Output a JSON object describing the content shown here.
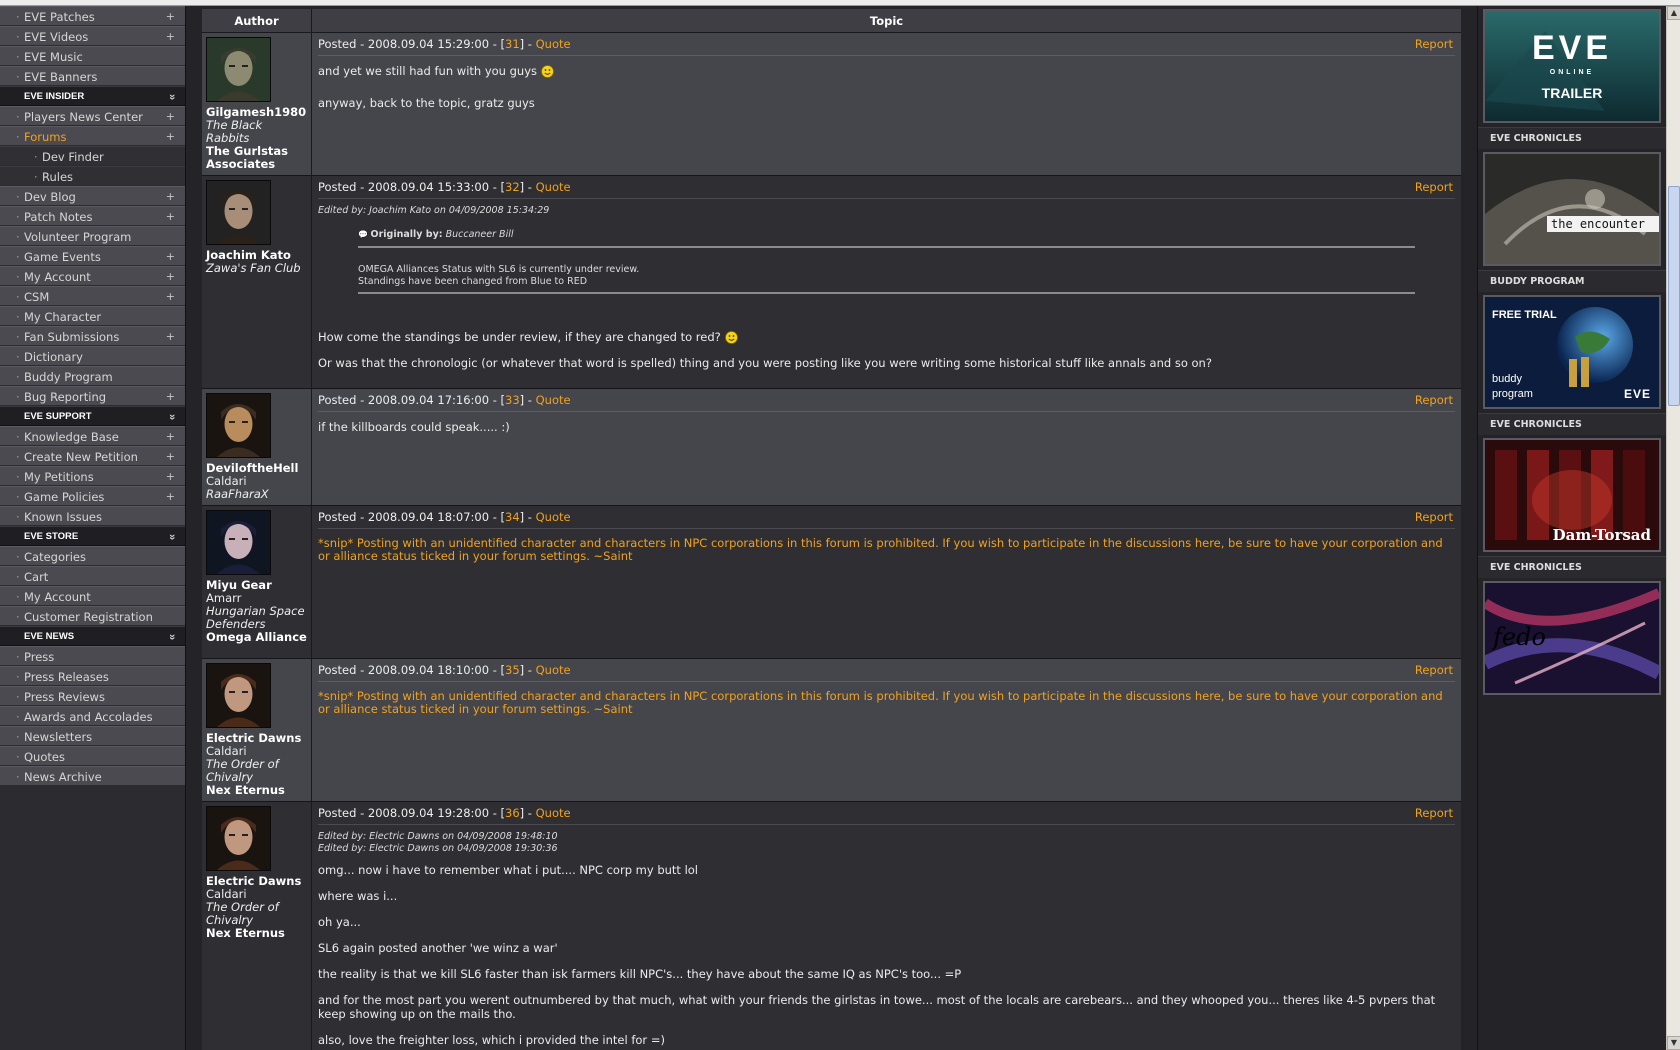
{
  "nav": {
    "groups": [
      {
        "heading": null,
        "items": [
          {
            "label": "EVE Patches",
            "plus": true
          },
          {
            "label": "EVE Videos",
            "plus": true
          },
          {
            "label": "EVE Music",
            "plus": false
          },
          {
            "label": "EVE Banners",
            "plus": false
          }
        ]
      },
      {
        "heading": "EVE INSIDER",
        "items": [
          {
            "label": "Players News Center",
            "plus": true
          },
          {
            "label": "Forums",
            "plus": true,
            "active": true
          },
          {
            "label": "Dev Finder",
            "plus": false,
            "sub": true
          },
          {
            "label": "Rules",
            "plus": false,
            "sub": true
          },
          {
            "label": "Dev Blog",
            "plus": true
          },
          {
            "label": "Patch Notes",
            "plus": true
          },
          {
            "label": "Volunteer Program",
            "plus": false
          },
          {
            "label": "Game Events",
            "plus": true
          },
          {
            "label": "My Account",
            "plus": true
          },
          {
            "label": "CSM",
            "plus": true
          },
          {
            "label": "My Character",
            "plus": false
          },
          {
            "label": "Fan Submissions",
            "plus": true
          },
          {
            "label": "Dictionary",
            "plus": false
          },
          {
            "label": "Buddy Program",
            "plus": false
          },
          {
            "label": "Bug Reporting",
            "plus": true
          }
        ]
      },
      {
        "heading": "EVE SUPPORT",
        "items": [
          {
            "label": "Knowledge Base",
            "plus": true
          },
          {
            "label": "Create New Petition",
            "plus": true
          },
          {
            "label": "My Petitions",
            "plus": true
          },
          {
            "label": "Game Policies",
            "plus": true
          },
          {
            "label": "Known Issues",
            "plus": false
          }
        ]
      },
      {
        "heading": "EVE STORE",
        "items": [
          {
            "label": "Categories",
            "plus": false
          },
          {
            "label": "Cart",
            "plus": false
          },
          {
            "label": "My Account",
            "plus": false
          },
          {
            "label": "Customer Registration",
            "plus": false
          }
        ]
      },
      {
        "heading": "EVE NEWS",
        "items": [
          {
            "label": "Press",
            "plus": false
          },
          {
            "label": "Press Releases",
            "plus": false
          },
          {
            "label": "Press Reviews",
            "plus": false
          },
          {
            "label": "Awards and Accolades",
            "plus": false
          },
          {
            "label": "Newsletters",
            "plus": false
          },
          {
            "label": "Quotes",
            "plus": false
          },
          {
            "label": "News Archive",
            "plus": false
          }
        ]
      }
    ]
  },
  "forum": {
    "headers": {
      "author": "Author",
      "topic": "Topic"
    },
    "quote_label": "Quote",
    "report_label": "Report",
    "posted_prefix": "Posted - ",
    "posts": [
      {
        "author": "Gilgamesh1980",
        "race": "",
        "corp": "The Black Rabbits",
        "alliance": "The Gurlstas Associates",
        "date": "2008.09.04 15:29:00",
        "num": "31",
        "avatar": "male1",
        "paragraphs": [
          "and yet we still had fun with you guys",
          "anyway, back to the topic, gratz guys"
        ],
        "smile_after": [
          0
        ]
      },
      {
        "author": "Joachim Kato",
        "race": "",
        "corp": "Zawa's Fan Club",
        "alliance": "",
        "date": "2008.09.04 15:33:00",
        "num": "32",
        "avatar": "male2",
        "edited": [
          "Edited by: Joachim Kato on 04/09/2008 15:34:29"
        ],
        "quote": {
          "label": "Originally by:",
          "who": "Buccaneer Bill",
          "lines": [
            "OMEGA Alliances Status with SL6 is currently under review.",
            "Standings have been changed from Blue to RED"
          ]
        },
        "paragraphs": [
          "How come the standings be under review, if they are changed to red?",
          "Or was that the chronologic (or whatever that word is spelled) thing and you were posting like you were writing some historical stuff like annals and so on?"
        ],
        "smile_after": [
          0
        ]
      },
      {
        "author": "DeviloftheHell",
        "race": "Caldari",
        "corp": "RaaFharaX",
        "alliance": "",
        "date": "2008.09.04 17:16:00",
        "num": "33",
        "avatar": "male3",
        "paragraphs": [
          "if the killboards could speak..... :)"
        ]
      },
      {
        "author": "Miyu Gear",
        "race": "Amarr",
        "corp": "Hungarian Space Defenders",
        "alliance": "Omega Alliance",
        "date": "2008.09.04 18:07:00",
        "num": "34",
        "avatar": "female1",
        "snip": "*snip* Posting with an unidentified character and characters in NPC corporations in this forum is prohibited. If you wish to participate in the discussions here, be sure to have your corporation and or alliance status ticked in your forum settings. ~Saint"
      },
      {
        "author": "Electric Dawns",
        "race": "Caldari",
        "corp": "The Order of Chivalry",
        "alliance": "Nex Eternus",
        "date": "2008.09.04 18:10:00",
        "num": "35",
        "avatar": "female2",
        "snip": "*snip* Posting with an unidentified character and characters in NPC corporations in this forum is prohibited. If you wish to participate in the discussions here, be sure to have your corporation and or alliance status ticked in your forum settings. ~Saint"
      },
      {
        "author": "Electric Dawns",
        "race": "Caldari",
        "corp": "The Order of Chivalry",
        "alliance": "Nex Eternus",
        "date": "2008.09.04 19:28:00",
        "num": "36",
        "avatar": "female2",
        "edited": [
          "Edited by: Electric Dawns on 04/09/2008 19:48:10",
          "Edited by: Electric Dawns on 04/09/2008 19:30:36"
        ],
        "paragraphs": [
          "omg... now i have to remember what i put.... NPC corp my butt lol",
          "where was i...",
          "oh ya...",
          "SL6 again posted another 'we winz a war'",
          "the reality is that we kill SL6 faster than isk farmers kill NPC's... they have about the same IQ as NPC's too... =P",
          "and for the most part you werent outnumbered by that much, what with your friends the girlstas in towe... most of the locals are carebears... and they whooped you... theres like 4-5 pvpers that keep showing up on the mails tho.",
          "also, love the freighter loss, which i provided the intel for =)"
        ]
      }
    ]
  },
  "rightbar": {
    "trailer": {
      "logo": "EVE",
      "sub": "ONLINE",
      "caption": "TRAILER"
    },
    "blocks": [
      {
        "label": "EVE CHRONICLES",
        "kind": "encounter",
        "caption": "the encounter"
      },
      {
        "label": "BUDDY PROGRAM",
        "kind": "buddy",
        "caption": "FREE TRIAL",
        "caption2": "buddy",
        "caption3": "program",
        "logo": "EVE"
      },
      {
        "label": "EVE CHRONICLES",
        "kind": "damtorsad",
        "caption": "Dam-Torsad"
      },
      {
        "label": "EVE CHRONICLES",
        "kind": "fedo",
        "caption": "fedo"
      }
    ]
  },
  "colors": {
    "accent": "#f2a21b",
    "row_light": "#45454c",
    "row_dark": "#2e2e33"
  }
}
